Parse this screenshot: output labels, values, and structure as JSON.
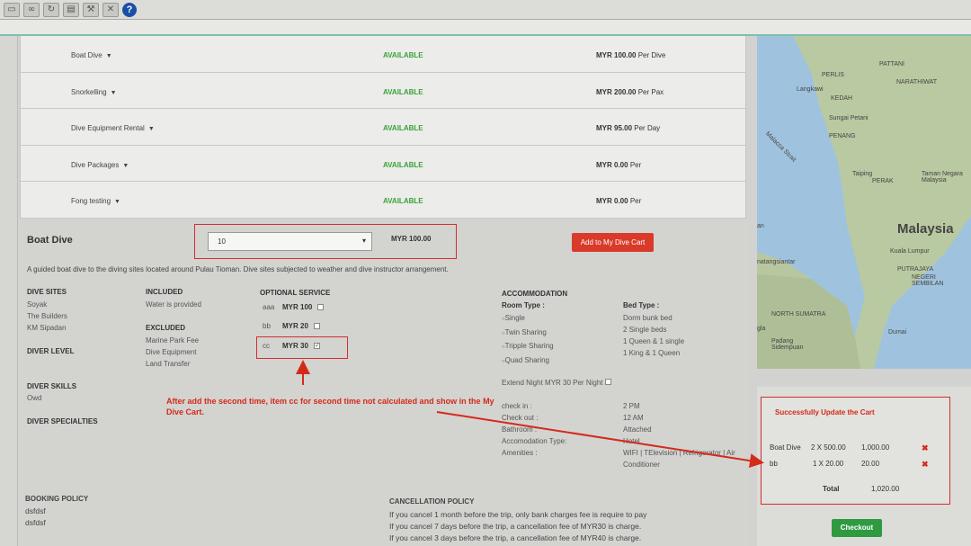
{
  "toolbar": {
    "icons": [
      "page-icon",
      "binoculars-icon",
      "refresh-icon",
      "print-icon",
      "tools-icon",
      "close-icon",
      "help-icon"
    ],
    "help_label": "?"
  },
  "services": [
    {
      "name": "Boat Dive",
      "status": "AVAILABLE",
      "price": "MYR 100.00",
      "unit": "Per Dive"
    },
    {
      "name": "Snorkelling",
      "status": "AVAILABLE",
      "price": "MYR 200.00",
      "unit": "Per Pax"
    },
    {
      "name": "Dive Equipment Rental",
      "status": "AVAILABLE",
      "price": "MYR 95.00",
      "unit": "Per Day"
    },
    {
      "name": "Dive Packages",
      "status": "AVAILABLE",
      "price": "MYR 0.00",
      "unit": "Per"
    },
    {
      "name": "Fong testing",
      "status": "AVAILABLE",
      "price": "MYR 0.00",
      "unit": "Per"
    }
  ],
  "detail": {
    "title": "Boat Dive",
    "quantity": "10",
    "price": "MYR 100.00",
    "add_button": "Add to My Dive Cart",
    "description": "A guided boat dive to the diving sites located around Pulau Tioman. Dive sites subjected to weather and dive instructor arrangement.",
    "dive_sites_title": "DIVE SITES",
    "dive_sites": [
      "Soyak",
      "The Builders",
      "KM Sipadan"
    ],
    "diver_level_title": "DIVER LEVEL",
    "diver_skills_title": "DIVER SKILLS",
    "diver_skills": "Owd",
    "diver_specialties_title": "DIVER SPECIALTIES",
    "included_title": "INCLUDED",
    "included": "Water is provided",
    "excluded_title": "EXCLUDED",
    "excluded": [
      "Marine Park Fee",
      "Dive Equipment",
      "Land Transfer"
    ],
    "optional_title": "OPTIONAL SERVICE",
    "optional": [
      {
        "code": "aaa",
        "price": "MYR  100",
        "checked": false
      },
      {
        "code": "bb",
        "price": "MYR  20",
        "checked": false
      },
      {
        "code": "cc",
        "price": "MYR  30",
        "checked": true
      }
    ],
    "accommodation_title": "ACCOMMODATION",
    "room_type_label": "Room Type :",
    "room_types": [
      "Single",
      "Twin Sharing",
      "Tripple Sharing",
      "Quad Sharing"
    ],
    "bed_type_label": "Bed Type :",
    "bed_types": [
      "Dorm bunk bed",
      "2 Single beds",
      "1 Queen & 1 single",
      "1 King & 1 Queen"
    ],
    "extend_night": "Extend Night MYR 30 Per Night",
    "checkin_label": "check in :",
    "checkin": "2 PM",
    "checkout_label": "Check out :",
    "checkout": "12 AM",
    "bathroom_label": "Bathroom :",
    "bathroom": "Attached",
    "acc_type_label": "Accomodation Type:",
    "acc_type": "Hotel",
    "amenities_label": "Amenities :",
    "amenities": "WIFI | TElevision | Refrigerator | Air Conditioner"
  },
  "annotation": "After add the second time, item cc for second time not calculated and show in the My Dive Cart.",
  "booking_policy": {
    "title": "BOOKING POLICY",
    "lines": [
      "dsfdsf",
      "dsfdsf"
    ]
  },
  "cancellation_policy": {
    "title": "CANCELLATION POLICY",
    "lines": [
      "If you cancel 1 month before the trip, only bank charges fee is require to pay",
      "If you cancel 7 days before the trip, a cancellation fee of MYR30 is charge.",
      "If you cancel 3 days before the trip, a cancellation fee of MYR40 is charge."
    ]
  },
  "map": {
    "labels": [
      "PATTANI",
      "NARATHIWAT",
      "Langkawi",
      "PERLIS",
      "KEDAH",
      "Sungai Petani",
      "PENANG",
      "Malacca Strait",
      "Taiping",
      "PERAK",
      "Taman Negara Malaysia",
      "Kuala Lumpur",
      "PUTRAJAYA",
      "NEGERI SEMBILAN",
      "NORTH SUMATRA",
      "Dumai",
      "Padang Sidempuan"
    ],
    "country": "Malaysia",
    "partial": [
      "an",
      "natangsiantar",
      "gla"
    ]
  },
  "cart": {
    "header": "Successfully Update the Cart",
    "items": [
      {
        "name": "Boat Dive",
        "qty": "2 X 500.00",
        "amount": "1,000.00"
      },
      {
        "name": "bb",
        "qty": "1 X 20.00",
        "amount": "20.00"
      }
    ],
    "total_label": "Total",
    "total": "1,020.00",
    "checkout": "Checkout",
    "remove_symbol": "✖"
  },
  "colors": {
    "accent_red": "#d93a2a",
    "available_green": "#3aa33a",
    "checkout_green": "#2f9a40"
  }
}
